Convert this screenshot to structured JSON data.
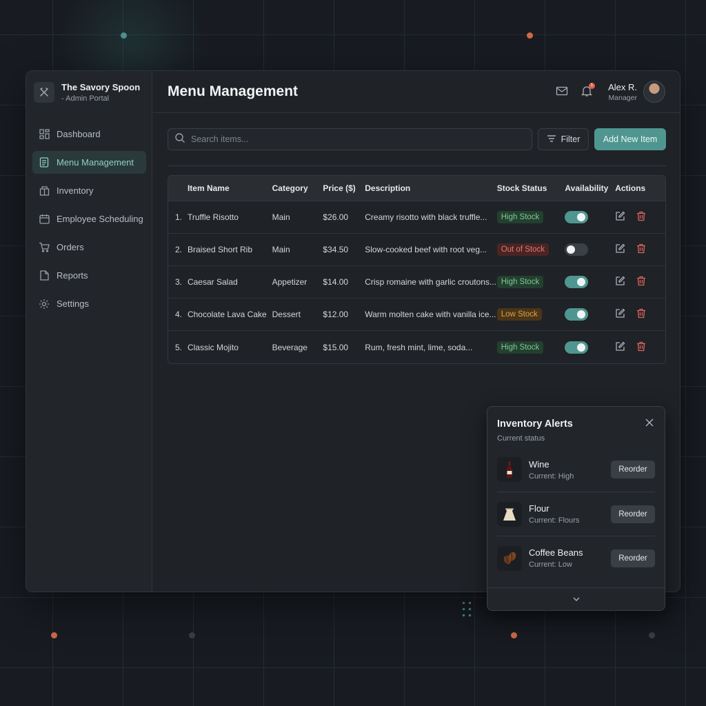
{
  "brand": {
    "name": "The Savory Spoon",
    "subtitle": "- Admin Portal",
    "logo_icon": "utensils-icon"
  },
  "sidebar": {
    "items": [
      {
        "label": "Dashboard",
        "icon": "grid-icon",
        "active": false
      },
      {
        "label": "Menu Management",
        "icon": "document-icon",
        "active": true
      },
      {
        "label": "Inventory",
        "icon": "box-icon",
        "active": false
      },
      {
        "label": "Employee Scheduling",
        "icon": "calendar-icon",
        "active": false
      },
      {
        "label": "Orders",
        "icon": "cart-icon",
        "active": false
      },
      {
        "label": "Reports",
        "icon": "file-icon",
        "active": false
      },
      {
        "label": "Settings",
        "icon": "gear-icon",
        "active": false
      }
    ]
  },
  "header": {
    "title": "Menu Management",
    "notification_count": "1",
    "user": {
      "name": "Alex R.",
      "role": "Manager"
    }
  },
  "toolbar": {
    "search_placeholder": "Search items...",
    "filter_label": "Filter",
    "add_label": "Add New Item"
  },
  "table": {
    "columns": [
      "Item Name",
      "Category",
      "Price ($)",
      "Description",
      "Stock Status",
      "Availability",
      "Actions"
    ],
    "rows": [
      {
        "num": "1.",
        "name": "Truffle Risotto",
        "category": "Main",
        "price": "$26.00",
        "description": "Creamy risotto with black truffle...",
        "stock": "High Stock",
        "stock_level": "high",
        "available": true
      },
      {
        "num": "2.",
        "name": "Braised Short Rib",
        "category": "Main",
        "price": "$34.50",
        "description": "Slow-cooked beef with root veg...",
        "stock": "Out of Stock",
        "stock_level": "out",
        "available": false
      },
      {
        "num": "3.",
        "name": "Caesar Salad",
        "category": "Appetizer",
        "price": "$14.00",
        "description": "Crisp romaine with garlic croutons...",
        "stock": "High Stock",
        "stock_level": "high",
        "available": true
      },
      {
        "num": "4.",
        "name": "Chocolate Lava Cake",
        "category": "Dessert",
        "price": "$12.00",
        "description": "Warm molten cake with vanilla ice...",
        "stock": "Low Stock",
        "stock_level": "low",
        "available": true
      },
      {
        "num": "5.",
        "name": "Classic Mojito",
        "category": "Beverage",
        "price": "$15.00",
        "description": "Rum, fresh mint, lime, soda...",
        "stock": "High Stock",
        "stock_level": "high",
        "available": true
      }
    ]
  },
  "alerts": {
    "title": "Inventory Alerts",
    "subtitle": "Current status",
    "reorder_label": "Reorder",
    "items": [
      {
        "name": "Wine",
        "current": "Current: High",
        "icon": "wine-bottle-icon"
      },
      {
        "name": "Flour",
        "current": "Current: Flours",
        "icon": "flour-sack-icon"
      },
      {
        "name": "Coffee Beans",
        "current": "Current: Low",
        "icon": "coffee-beans-icon"
      }
    ]
  },
  "colors": {
    "accent": "#4f9690",
    "status_high_bg": "#23402f",
    "status_high_fg": "#7fc79a",
    "status_out_bg": "#4a2424",
    "status_out_fg": "#e07a6e",
    "status_low_bg": "#4a3518",
    "status_low_fg": "#e2a04a",
    "delete_icon": "#d9685a"
  }
}
